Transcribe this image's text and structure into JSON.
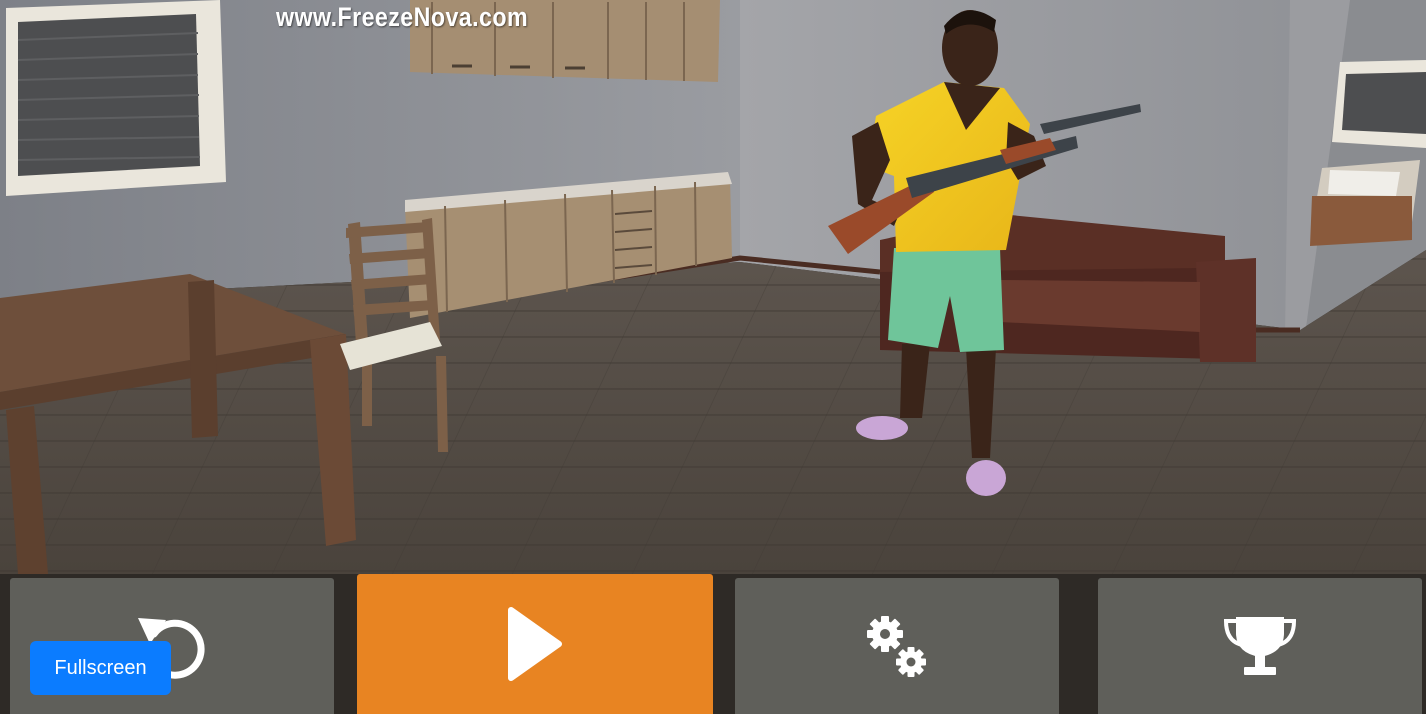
{
  "watermark": "www.FreezeNova.com",
  "toolbar": {
    "restart_icon": "restart-icon",
    "play_icon": "play-icon",
    "settings_icon": "gears-icon",
    "trophy_icon": "trophy-icon"
  },
  "fullscreen_label": "Fullscreen",
  "colors": {
    "play_button": "#e88422",
    "toolbar_button": "#5f5f5a",
    "fullscreen_button": "#0b7cff",
    "icon": "#ffffff"
  }
}
